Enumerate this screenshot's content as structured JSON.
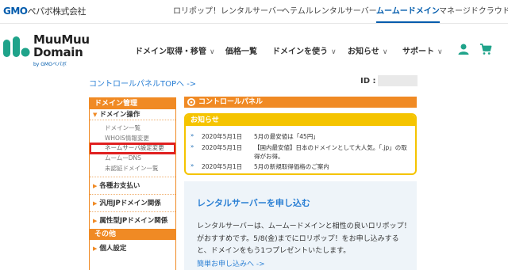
{
  "topbar": {
    "logo_gmo": "GMO",
    "logo_rest": "ペパボ株式会社",
    "links": [
      "ロリポップ！レンタルサーバー",
      "ヘテムルレンタルサーバー",
      "ムームードメイン",
      "マネージドクラウド"
    ]
  },
  "brand": {
    "line1": "MuuMuu",
    "line2": "Domain",
    "sub": "by GMOペパボ"
  },
  "mainnav": {
    "items": [
      "ドメイン取得・移管",
      "価格一覧",
      "ドメインを使う",
      "お知らせ",
      "サポート"
    ],
    "chevron": "∨"
  },
  "header_bar": {
    "cp_top": "コントロールパネルTOPへ ->",
    "id_label": "ID :"
  },
  "sidebar": {
    "head": "ドメイン管理",
    "section1": "ドメイン操作",
    "subs": [
      "ドメイン一覧",
      "WHOIS情報変更",
      "ネームサーバ設定変更",
      "ムームーDNS",
      "未認証ドメイン一覧"
    ],
    "blocks1": [
      "各種お支払い",
      "汎用JPドメイン関係",
      "属性型JPドメイン関係"
    ],
    "head2": "その他",
    "blocks2": [
      "個人設定"
    ],
    "arrow": "▶",
    "down_arrow": "▼"
  },
  "control_panel": {
    "title": "コントロールパネル"
  },
  "notices": {
    "head": "お知らせ",
    "bullet": "»",
    "rows": [
      {
        "date": "2020年5月1日",
        "text": "5月の最安値は「45円」"
      },
      {
        "date": "2020年5月1日",
        "text": "【国内最安値】日本のドメインとして大人気。「.jp」の取得がお得。"
      },
      {
        "date": "2020年5月1日",
        "text": "5月の新規取得価格のご案内"
      }
    ]
  },
  "promo": {
    "title": "レンタルサーバーを申し込む",
    "body": "レンタルサーバーは、ムームードメインと相性の良いロリポップ！がおすすめです。5/8(金)までにロリポップ！をお申し込みすると、ドメインをもう1つプレゼントいたします。",
    "link": "簡単お申し込みへ ->"
  },
  "colors": {
    "accent_orange": "#f08a24",
    "notice_yellow": "#f5c400",
    "link_blue": "#2a7fd4",
    "highlight_red": "#e02020",
    "brand_teal": "#1fa38a"
  },
  "icons": {
    "user": "user-icon",
    "cart": "cart-icon",
    "gear": "gear-icon"
  }
}
